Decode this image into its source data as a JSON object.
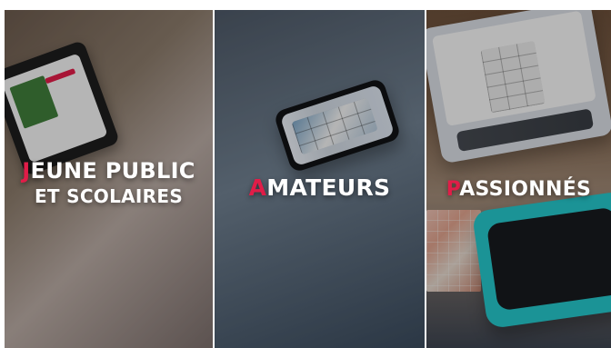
{
  "panels": [
    {
      "id": "jeune-public",
      "caption": {
        "line1": {
          "accent": "J",
          "rest": "EUNE PUBLIC"
        },
        "line2": "ET SCOLAIRES"
      }
    },
    {
      "id": "amateurs",
      "caption": {
        "line1": {
          "accent": "A",
          "rest": "MATEURS"
        }
      }
    },
    {
      "id": "passionnes",
      "caption": {
        "line1": {
          "accent": "P",
          "rest": "ASSIONNÉS"
        }
      }
    }
  ],
  "colors": {
    "accent": "#e11d48",
    "caption": "#ffffff",
    "pad": "#25c4c8"
  },
  "icons": [
    "tablet-icon",
    "phone-icon",
    "laptop-icon",
    "drawing-tablet-icon",
    "color-swatches-icon"
  ]
}
